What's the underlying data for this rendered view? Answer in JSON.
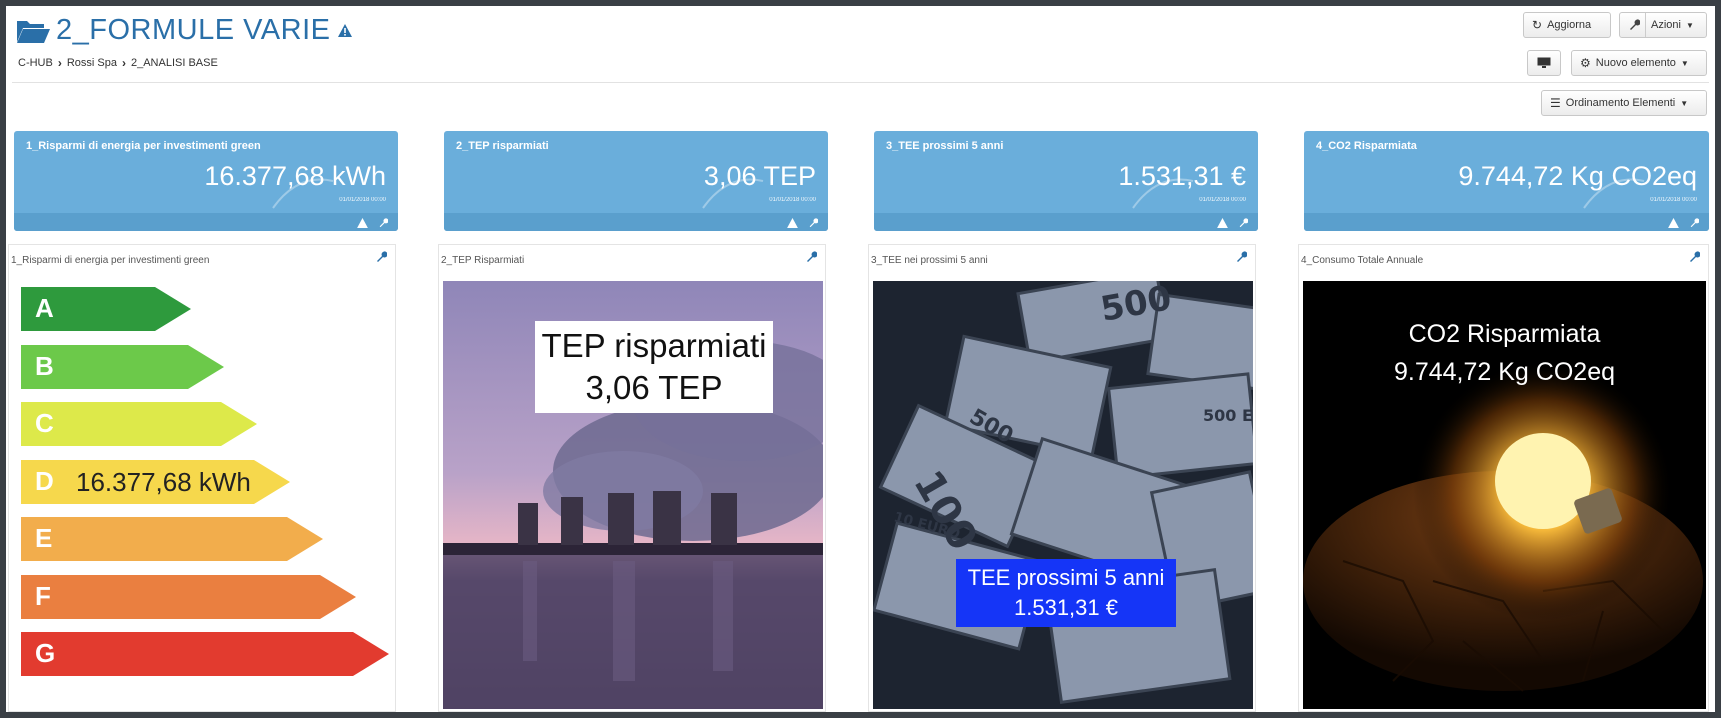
{
  "header": {
    "title": "2_FORMULE VARIE",
    "breadcrumb": [
      "C-HUB",
      "Rossi Spa",
      "2_ANALISI BASE"
    ]
  },
  "toolbar": {
    "refresh_label": "Aggiorna",
    "actions_label": "Azioni",
    "new_element_label": "Nuovo elemento",
    "order_label": "Ordinamento Elementi"
  },
  "kpis": [
    {
      "label": "1_Risparmi di energia per investimenti green",
      "value": "16.377,68 kWh",
      "date": "01/01/2018 00:00"
    },
    {
      "label": "2_TEP risparmiati",
      "value": "3,06 TEP",
      "date": "01/01/2018 00:00"
    },
    {
      "label": "3_TEE prossimi 5 anni",
      "value": "1.531,31 €",
      "date": "01/01/2018 00:00"
    },
    {
      "label": "4_CO2 Risparmiata",
      "value": "9.744,72 Kg CO2eq",
      "date": "01/01/2018 00:00"
    }
  ],
  "widgets": [
    {
      "label": "1_Risparmi di energia per investimenti green",
      "energy_classes": [
        "A",
        "B",
        "C",
        "D",
        "E",
        "F",
        "G"
      ],
      "class_colors": [
        "#2e9a3d",
        "#6cc94a",
        "#dde94a",
        "#f6d84c",
        "#f2ad4c",
        "#ea7f40",
        "#e23b2f"
      ],
      "reading": "16.377,68 kWh"
    },
    {
      "label": "2_TEP Risparmiati",
      "overlay_title": "TEP risparmiati",
      "overlay_value": "3,06 TEP"
    },
    {
      "label": "3_TEE nei prossimi 5 anni",
      "overlay_title": "TEE prossimi 5 anni",
      "overlay_value": "1.531,31 €"
    },
    {
      "label": "4_Consumo Totale Annuale",
      "overlay_title": "CO2 Risparmiata",
      "overlay_value": "9.744,72 Kg CO2eq"
    }
  ],
  "colors": {
    "kpi_bg": "#6aaedb",
    "title_blue": "#2a6fa8",
    "tee_box": "#1535f7"
  },
  "icons": [
    "folder-open-icon",
    "warning-icon",
    "refresh-icon",
    "wrench-icon",
    "caret-down-icon",
    "monitor-icon",
    "gear-icon",
    "list-icon"
  ]
}
